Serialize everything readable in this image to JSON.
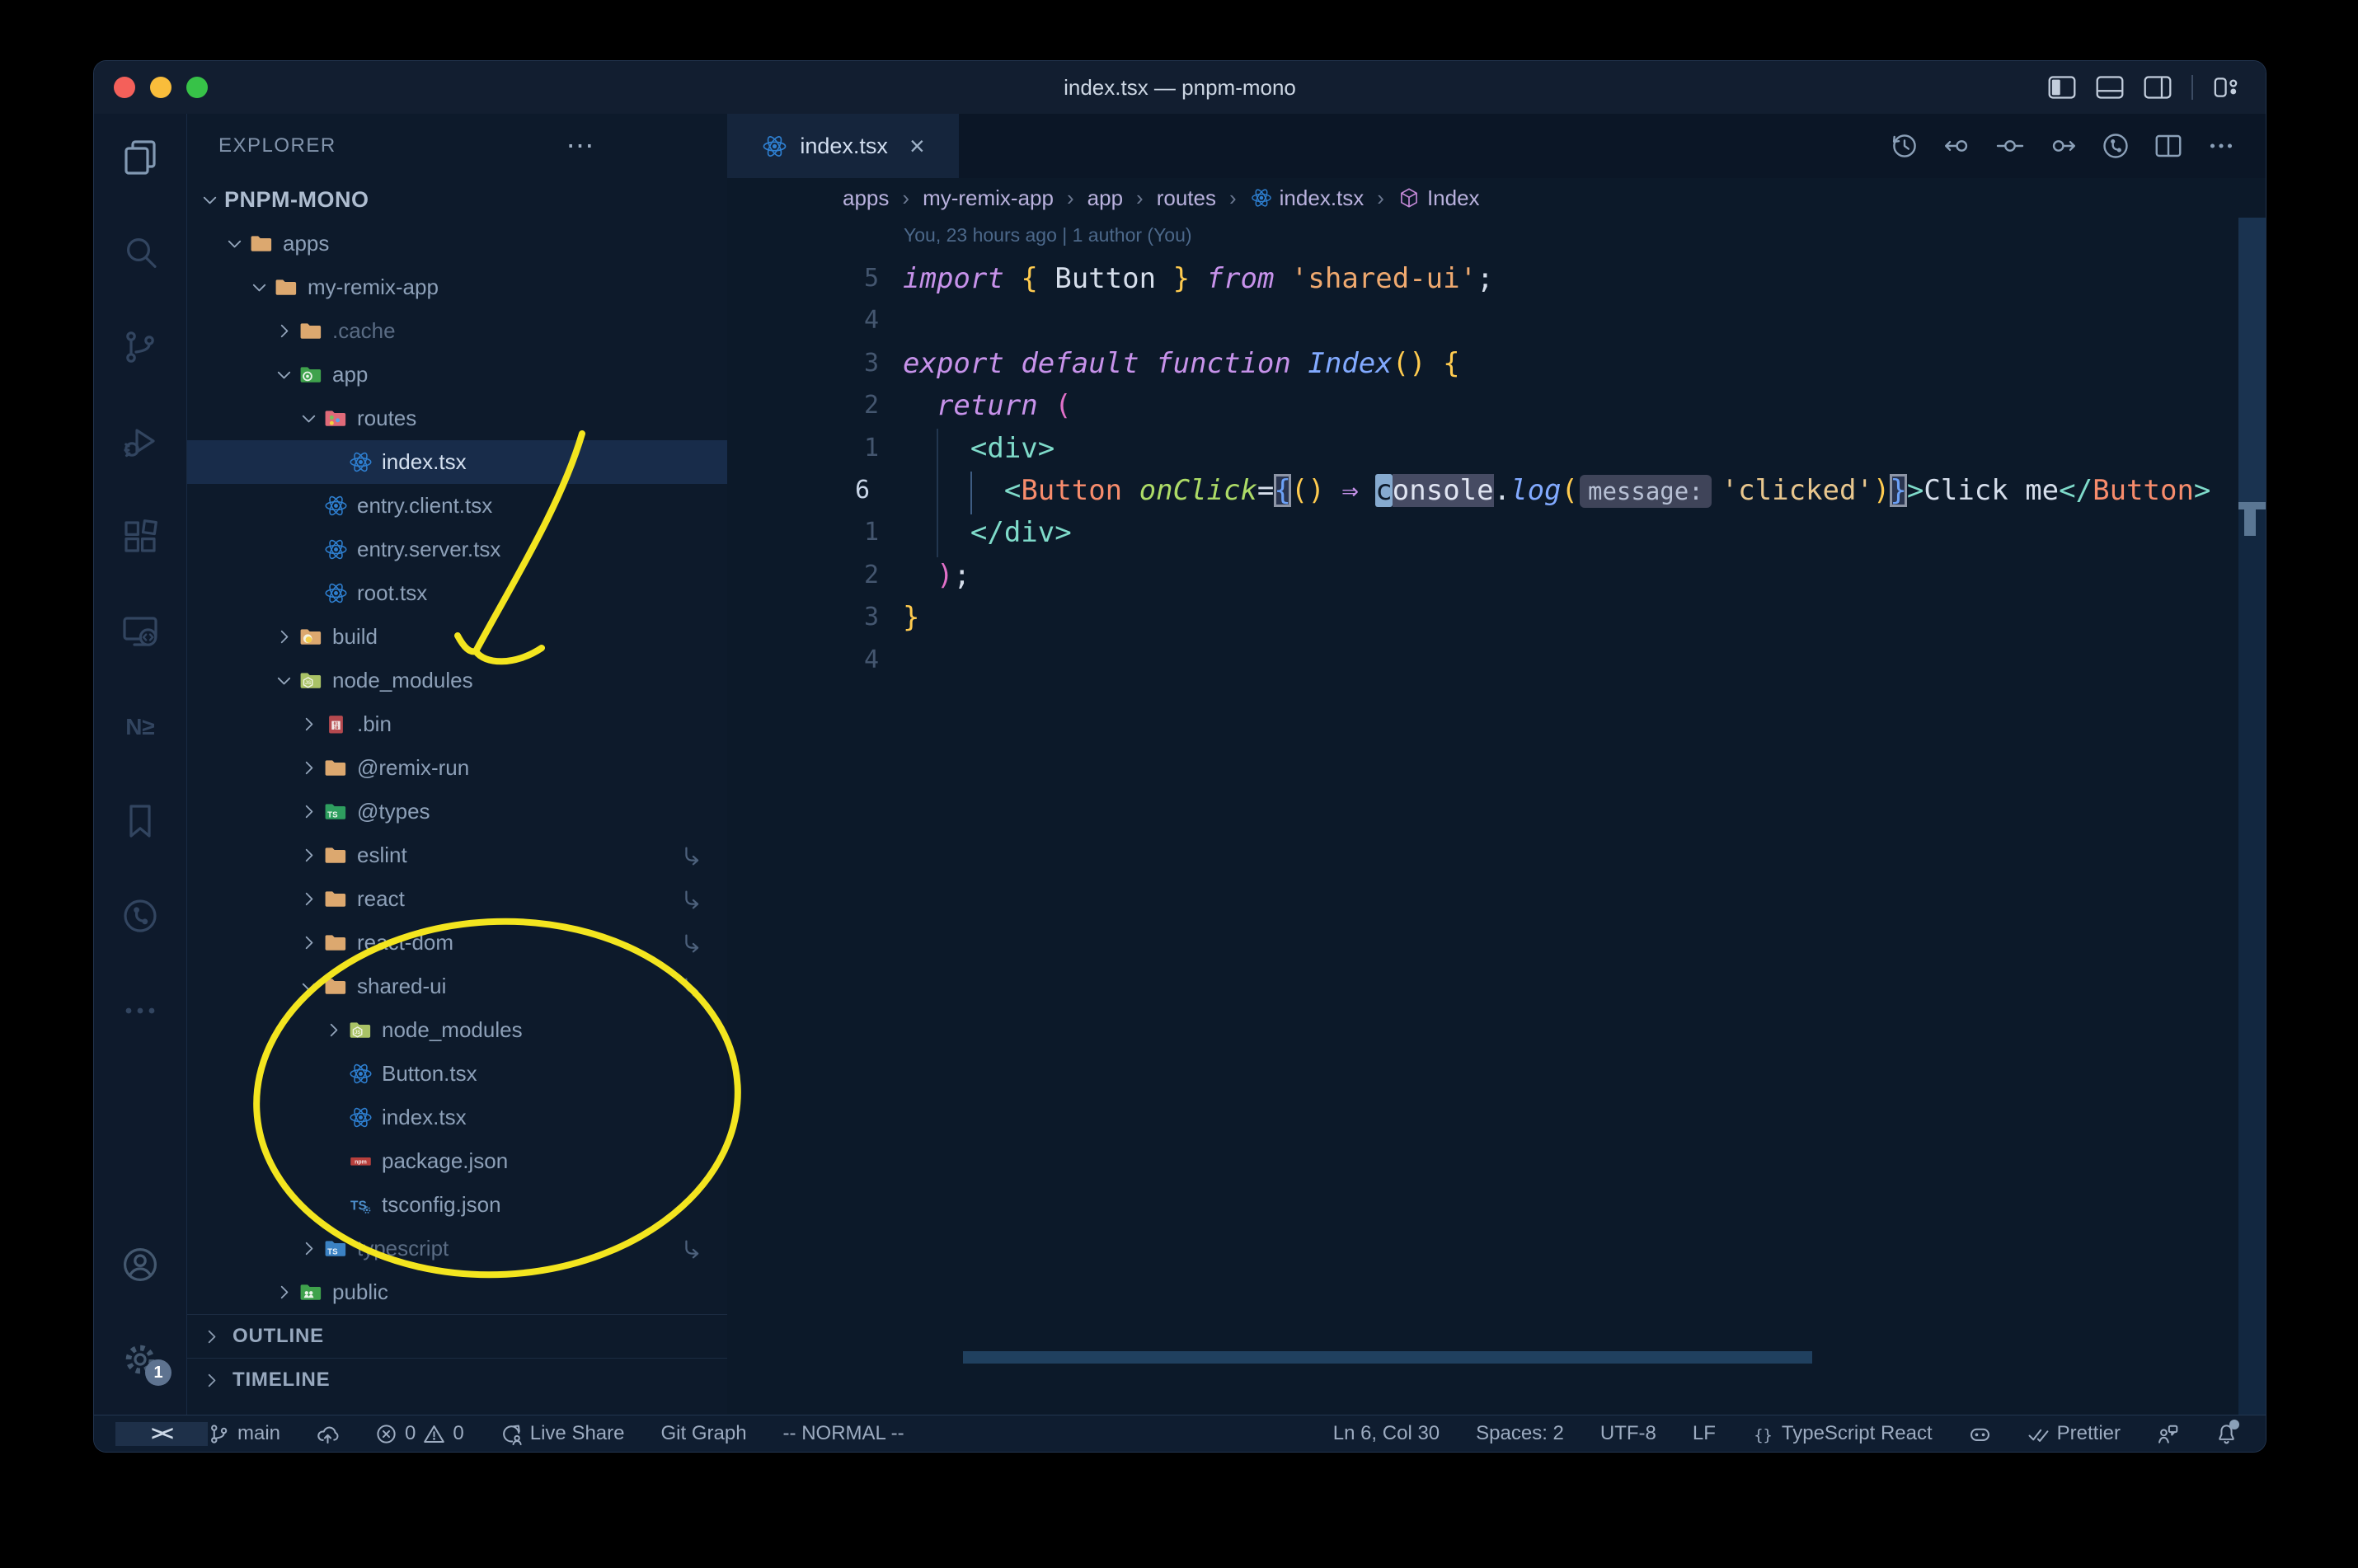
{
  "window": {
    "title": "index.tsx — pnpm-mono"
  },
  "titlebar_actions": [
    {
      "name": "layout-sidebar-toggle-icon",
      "icon": "layout-sidebar"
    },
    {
      "name": "layout-panel-toggle-icon",
      "icon": "layout-panel"
    },
    {
      "name": "layout-secondary-sidebar-icon",
      "icon": "layout-sidebar-right"
    },
    {
      "name": "separator",
      "icon": "separator"
    },
    {
      "name": "layout-customize-icon",
      "icon": "layout-customize"
    }
  ],
  "activity_bar": {
    "top": [
      {
        "name": "explorer",
        "active": true
      },
      {
        "name": "search"
      },
      {
        "name": "source-control"
      },
      {
        "name": "run-debug"
      },
      {
        "name": "extensions"
      },
      {
        "name": "remote-explorer"
      },
      {
        "name": "nx-console",
        "text": "N≥"
      },
      {
        "name": "bookmarks"
      },
      {
        "name": "git-graph"
      },
      {
        "name": "more"
      }
    ],
    "bottom": [
      {
        "name": "account"
      },
      {
        "name": "settings",
        "badge": "1"
      }
    ]
  },
  "explorer": {
    "header": "EXPLORER",
    "header_menu": "⋯",
    "outline": "OUTLINE",
    "timeline": "TIMELINE",
    "tree": [
      {
        "label": "PNPM-MONO",
        "level": 0,
        "chevron": "down",
        "icon": null,
        "root": true
      },
      {
        "label": "apps",
        "level": 1,
        "chevron": "down",
        "icon": "folder-tan"
      },
      {
        "label": "my-remix-app",
        "level": 2,
        "chevron": "down",
        "icon": "folder-tan"
      },
      {
        "label": ".cache",
        "level": 3,
        "chevron": "right",
        "icon": "folder-tan",
        "dim": true
      },
      {
        "label": "app",
        "level": 3,
        "chevron": "down",
        "icon": "folder-app"
      },
      {
        "label": "routes",
        "level": 4,
        "chevron": "down",
        "icon": "folder-routes"
      },
      {
        "label": "index.tsx",
        "level": 5,
        "chevron": null,
        "icon": "file-react",
        "selected": true
      },
      {
        "label": "entry.client.tsx",
        "level": 4,
        "chevron": null,
        "icon": "file-react"
      },
      {
        "label": "entry.server.tsx",
        "level": 4,
        "chevron": null,
        "icon": "file-react"
      },
      {
        "label": "root.tsx",
        "level": 4,
        "chevron": null,
        "icon": "file-react"
      },
      {
        "label": "build",
        "level": 3,
        "chevron": "right",
        "icon": "folder-build"
      },
      {
        "label": "node_modules",
        "level": 3,
        "chevron": "down",
        "icon": "folder-node-modules"
      },
      {
        "label": ".bin",
        "level": 4,
        "chevron": "right",
        "icon": "file-binary"
      },
      {
        "label": "@remix-run",
        "level": 4,
        "chevron": "right",
        "icon": "folder-tan"
      },
      {
        "label": "@types",
        "level": 4,
        "chevron": "right",
        "icon": "folder-types"
      },
      {
        "label": "eslint",
        "level": 4,
        "chevron": "right",
        "icon": "folder-tan",
        "symlink": true
      },
      {
        "label": "react",
        "level": 4,
        "chevron": "right",
        "icon": "folder-tan",
        "symlink": true
      },
      {
        "label": "react-dom",
        "level": 4,
        "chevron": "right",
        "icon": "folder-tan",
        "symlink": true
      },
      {
        "label": "shared-ui",
        "level": 4,
        "chevron": "down",
        "icon": "folder-tan",
        "symlink": true
      },
      {
        "label": "node_modules",
        "level": 5,
        "chevron": "right",
        "icon": "folder-node-modules"
      },
      {
        "label": "Button.tsx",
        "level": 5,
        "chevron": null,
        "icon": "file-react"
      },
      {
        "label": "index.tsx",
        "level": 5,
        "chevron": null,
        "icon": "file-react"
      },
      {
        "label": "package.json",
        "level": 5,
        "chevron": null,
        "icon": "file-npm"
      },
      {
        "label": "tsconfig.json",
        "level": 5,
        "chevron": null,
        "icon": "file-tsconfig"
      },
      {
        "label": "typescript",
        "level": 4,
        "chevron": "right",
        "icon": "folder-ts-blue",
        "dim": true,
        "symlink": true
      },
      {
        "label": "public",
        "level": 3,
        "chevron": "right",
        "icon": "folder-public"
      }
    ]
  },
  "editor": {
    "tab": {
      "label": "index.tsx",
      "icon": "file-react",
      "close": "×"
    },
    "toolbar": [
      {
        "name": "timeline-history-icon",
        "icon": "timeline-history"
      },
      {
        "name": "commit-prev-icon",
        "icon": "commit-prev"
      },
      {
        "name": "commit-current-icon",
        "icon": "commit-current"
      },
      {
        "name": "commit-next-icon",
        "icon": "commit-next"
      },
      {
        "name": "git-graph-circle-icon",
        "icon": "git-graph-circle"
      },
      {
        "name": "split-editor-icon",
        "icon": "split-editor"
      },
      {
        "name": "more-actions-icon",
        "icon": "more-actions"
      }
    ],
    "breadcrumbs": [
      {
        "label": "apps"
      },
      {
        "label": "my-remix-app"
      },
      {
        "label": "app"
      },
      {
        "label": "routes"
      },
      {
        "label": "index.tsx",
        "icon": "file-react"
      },
      {
        "label": "Index",
        "icon": "symbol-cube"
      }
    ],
    "blame": "You, 23 hours ago | 1 author (You)",
    "current_line_index": 5,
    "lines": [
      {
        "num": "5",
        "seg": [
          [
            "import",
            "kw"
          ],
          [
            " ",
            "w"
          ],
          [
            "{",
            "y"
          ],
          [
            " Button ",
            "w"
          ],
          [
            "}",
            "y"
          ],
          [
            " ",
            "w"
          ],
          [
            "from",
            "kw"
          ],
          [
            " ",
            "w"
          ],
          [
            "'shared-ui'",
            "str"
          ],
          [
            ";",
            "w"
          ]
        ]
      },
      {
        "num": "4",
        "seg": []
      },
      {
        "num": "3",
        "seg": [
          [
            "export",
            "kw"
          ],
          [
            " ",
            "w"
          ],
          [
            "default",
            "kw"
          ],
          [
            " ",
            "w"
          ],
          [
            "function",
            "kw"
          ],
          [
            " ",
            "w"
          ],
          [
            "Index",
            "fn"
          ],
          [
            "()",
            "y"
          ],
          [
            " ",
            "w"
          ],
          [
            "{",
            "y"
          ]
        ]
      },
      {
        "num": "2",
        "seg": [
          [
            "  ",
            "w"
          ],
          [
            "return",
            "kw"
          ],
          [
            " ",
            "w"
          ],
          [
            "(",
            "pk"
          ]
        ]
      },
      {
        "num": "1",
        "seg": [
          [
            "    ",
            "w"
          ],
          [
            "<div>",
            "teal"
          ]
        ]
      },
      {
        "num": "6",
        "seg": [
          [
            "      ",
            "w"
          ],
          [
            "<",
            "teal"
          ],
          [
            "Button",
            "tag"
          ],
          [
            " ",
            "w"
          ],
          [
            "onClick",
            "attr"
          ],
          [
            "=",
            "w"
          ],
          [
            "{",
            "bx"
          ],
          [
            "()",
            "y"
          ],
          [
            " ",
            "w"
          ],
          [
            "⇒",
            "arw"
          ],
          [
            " ",
            "w"
          ],
          [
            "c",
            "cur"
          ],
          [
            "onsole",
            "hl"
          ],
          [
            ".",
            "w"
          ],
          [
            "log",
            "fn"
          ],
          [
            "(",
            "y"
          ],
          [
            "message:",
            "inlay"
          ],
          [
            "'clicked'",
            "str2"
          ],
          [
            ")",
            "y"
          ],
          [
            "}",
            "bx"
          ],
          [
            ">",
            "teal"
          ],
          [
            "Click me",
            "w"
          ],
          [
            "</",
            "teal"
          ],
          [
            "Button",
            "tag"
          ],
          [
            ">",
            "teal"
          ]
        ]
      },
      {
        "num": "1",
        "seg": [
          [
            "    ",
            "w"
          ],
          [
            "</div>",
            "teal"
          ]
        ]
      },
      {
        "num": "2",
        "seg": [
          [
            "  ",
            "w"
          ],
          [
            ")",
            "pk"
          ],
          [
            ";",
            "w"
          ]
        ]
      },
      {
        "num": "3",
        "seg": [
          [
            "}",
            "y"
          ]
        ]
      },
      {
        "num": "4",
        "seg": []
      }
    ]
  },
  "status_bar": {
    "left": [
      {
        "name": "remote-indicator",
        "chip": true,
        "label": "><"
      },
      {
        "name": "git-branch",
        "icon": "git-branch",
        "label": "main"
      },
      {
        "name": "sync-changes",
        "icon": "cloud-sync"
      },
      {
        "name": "problems",
        "icon": "error",
        "label": "0",
        "icon2": "warning",
        "label2": "0"
      },
      {
        "name": "live-share",
        "icon": "live-share",
        "label": "Live Share"
      },
      {
        "name": "git-graph",
        "label": "Git Graph"
      },
      {
        "name": "vim-mode",
        "label": "-- NORMAL --"
      }
    ],
    "right": [
      {
        "name": "cursor-position",
        "label": "Ln 6, Col 30"
      },
      {
        "name": "indentation",
        "label": "Spaces: 2"
      },
      {
        "name": "encoding",
        "label": "UTF-8"
      },
      {
        "name": "eol",
        "label": "LF"
      },
      {
        "name": "language-mode",
        "icon": "braces",
        "label": "TypeScript React"
      },
      {
        "name": "copilot",
        "icon": "copilot"
      },
      {
        "name": "prettier",
        "icon": "double-check",
        "label": "Prettier"
      },
      {
        "name": "feedback",
        "icon": "feedback"
      },
      {
        "name": "notifications",
        "icon": "bell",
        "badge": true
      }
    ]
  },
  "window_controls": {
    "close": "#f4605a",
    "minimize": "#f9bd3b",
    "zoom": "#37c248"
  },
  "annotations": {
    "color": "#f3e51f",
    "items": [
      {
        "type": "arrow",
        "target": "node_modules folder"
      },
      {
        "type": "ellipse",
        "target": "shared-ui folder contents"
      }
    ]
  }
}
